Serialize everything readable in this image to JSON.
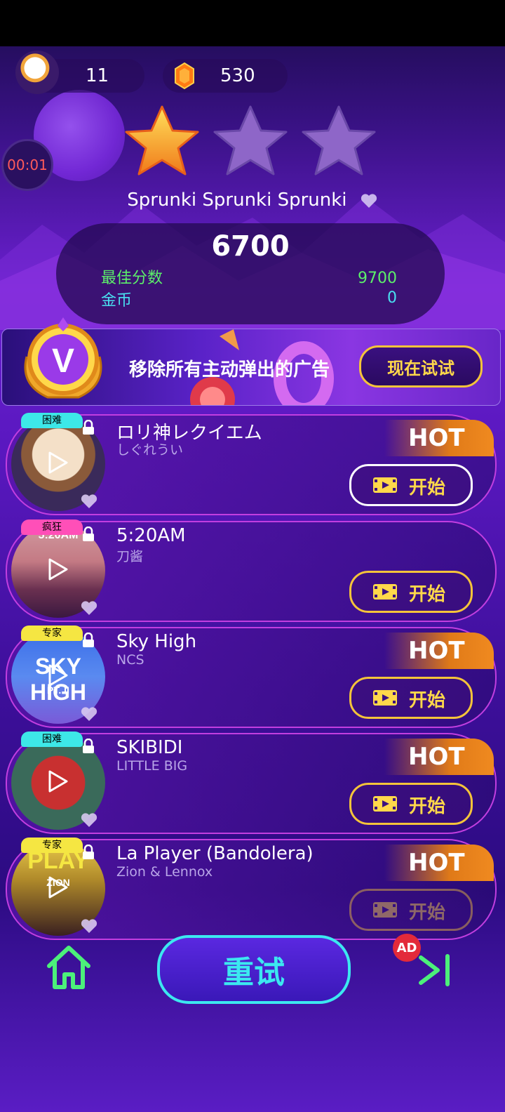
{
  "header": {
    "lives_count": "11",
    "gems_count": "530",
    "timer": "00:01"
  },
  "result": {
    "stars_earned": 1,
    "stars_total": 3,
    "song_title": "Sprunki Sprunki Sprunki",
    "score": "6700",
    "best_label": "最佳分数",
    "best_value": "9700",
    "coins_label": "金币",
    "coins_value": "0"
  },
  "banner": {
    "badge_letter": "V",
    "text": "移除所有主动弹出的广告",
    "button": "现在试试"
  },
  "songs": [
    {
      "tag": "困难",
      "tag_color": "#3de8e8",
      "title": "ロリ神レクイエム",
      "artist": "しぐれうい",
      "hot": "HOT",
      "button": "开始"
    },
    {
      "tag": "疯狂",
      "tag_color": "#ff4fb8",
      "title": "5:20AM",
      "artist": "刀酱",
      "hot": "",
      "button": "开始"
    },
    {
      "tag": "专家",
      "tag_color": "#f5e642",
      "title": "Sky High",
      "artist": "NCS",
      "hot": "HOT",
      "button": "开始"
    },
    {
      "tag": "困难",
      "tag_color": "#3de8e8",
      "title": "SKIBIDI",
      "artist": "LITTLE BIG",
      "hot": "HOT",
      "button": "开始"
    },
    {
      "tag": "专家",
      "tag_color": "#f5e642",
      "title": "La Player (Bandolera)",
      "artist": "Zion & Lennox",
      "hot": "HOT",
      "button": "开始"
    }
  ],
  "covers": {
    "sky_high_art_text": "SKY HIGH",
    "sky_high_art_sub": "PT. II",
    "five_twenty_art_text": "5:20AM",
    "la_player_art_text": "PLAY",
    "la_player_art_sub": "ZION"
  },
  "footer": {
    "retry": "重试",
    "ad_badge": "AD"
  },
  "colors": {
    "accent_yellow": "#f5c43a",
    "retry_cyan": "#3ce8f0",
    "best_green": "#5cf06a",
    "coins_cyan": "#4ae0f0",
    "hot_orange": "#f08a20"
  }
}
